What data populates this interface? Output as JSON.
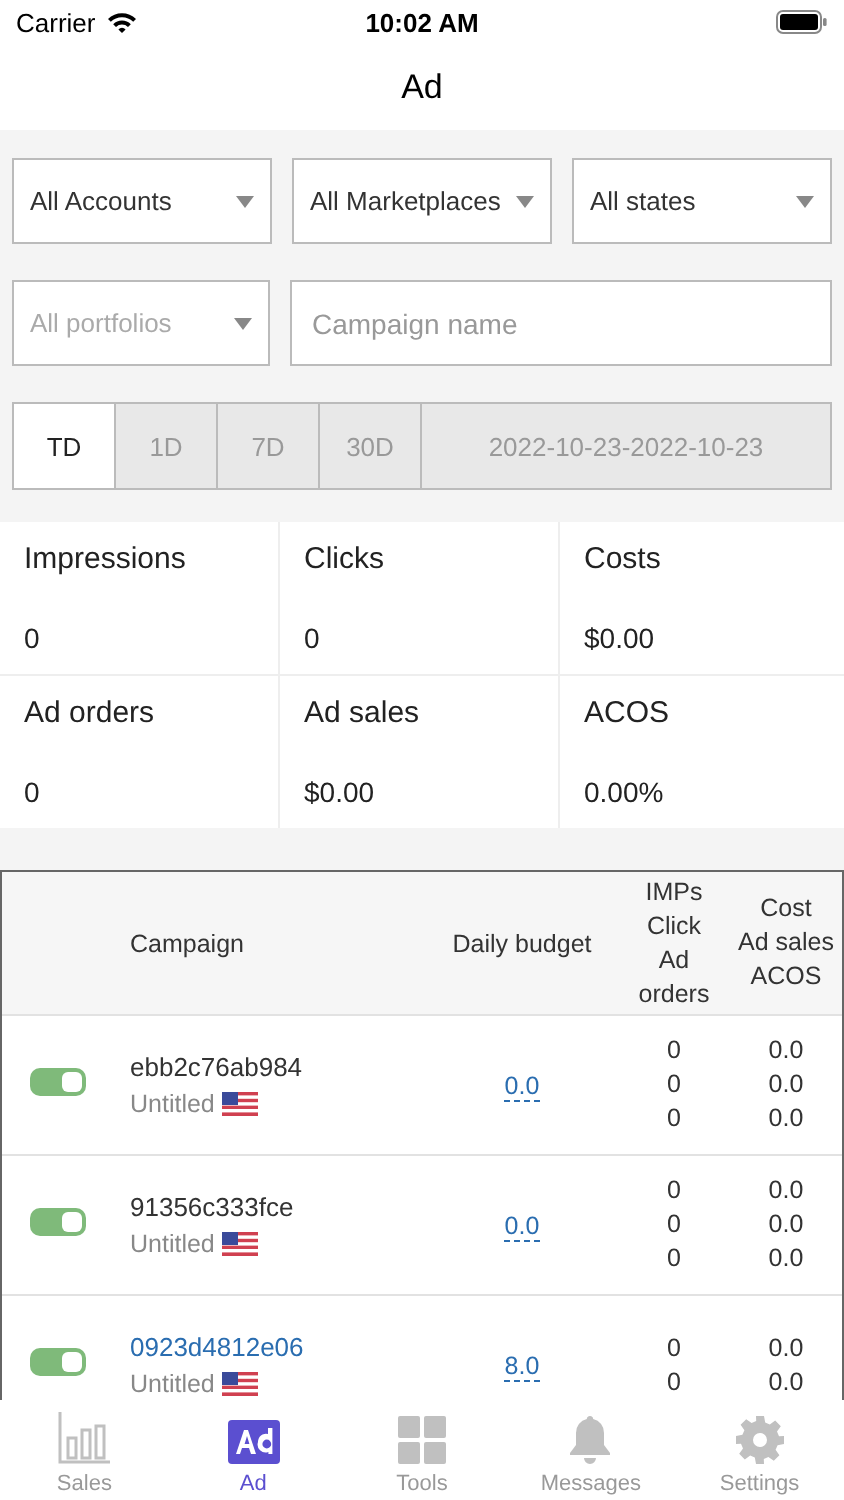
{
  "status_bar": {
    "carrier": "Carrier",
    "time": "10:02 AM"
  },
  "nav": {
    "title": "Ad"
  },
  "filters": {
    "selects": [
      {
        "label": "All Accounts",
        "placeholder": false
      },
      {
        "label": "All Marketplaces",
        "placeholder": false
      },
      {
        "label": "All states",
        "placeholder": false
      }
    ],
    "portfolio": {
      "label": "All portfolios",
      "placeholder": true
    },
    "search": {
      "placeholder": "Campaign name"
    }
  },
  "ranges": [
    {
      "label": "TD",
      "selected": true
    },
    {
      "label": "1D",
      "selected": false
    },
    {
      "label": "7D",
      "selected": false
    },
    {
      "label": "30D",
      "selected": false
    },
    {
      "label": "2022-10-23-2022-10-23",
      "selected": false
    }
  ],
  "stats": [
    {
      "label": "Impressions",
      "value": "0"
    },
    {
      "label": "Clicks",
      "value": "0"
    },
    {
      "label": "Costs",
      "value": "$0.00"
    },
    {
      "label": "Ad orders",
      "value": "0"
    },
    {
      "label": "Ad sales",
      "value": "$0.00"
    },
    {
      "label": "ACOS",
      "value": "0.00%"
    }
  ],
  "table": {
    "columns": [
      "Campaign",
      "Daily budget",
      [
        "IMPs",
        "Click",
        "Ad",
        "orders"
      ],
      [
        "Cost",
        "Ad sales",
        "ACOS"
      ]
    ],
    "rows": [
      {
        "on": true,
        "name": "ebb2c76ab984",
        "linked": false,
        "portfolio": "Untitled",
        "budget": "0.0",
        "metrics_a": [
          "0",
          "0",
          "0"
        ],
        "metrics_b": [
          "0.0",
          "0.0",
          "0.0"
        ]
      },
      {
        "on": true,
        "name": "91356c333fce",
        "linked": false,
        "portfolio": "Untitled",
        "budget": "0.0",
        "metrics_a": [
          "0",
          "0",
          "0"
        ],
        "metrics_b": [
          "0.0",
          "0.0",
          "0.0"
        ]
      },
      {
        "on": true,
        "name": "0923d4812e06",
        "linked": true,
        "portfolio": "Untitled",
        "budget": "8.0",
        "metrics_a": [
          "0",
          "0"
        ],
        "metrics_b": [
          "0.0",
          "0.0"
        ]
      }
    ]
  },
  "tab_bar": [
    {
      "label": "Sales",
      "kind": "chart",
      "selected": false
    },
    {
      "label": "Ad",
      "kind": "ad",
      "selected": true
    },
    {
      "label": "Tools",
      "kind": "grid",
      "selected": false
    },
    {
      "label": "Messages",
      "kind": "bell",
      "selected": false
    },
    {
      "label": "Settings",
      "kind": "gear",
      "selected": false
    }
  ]
}
